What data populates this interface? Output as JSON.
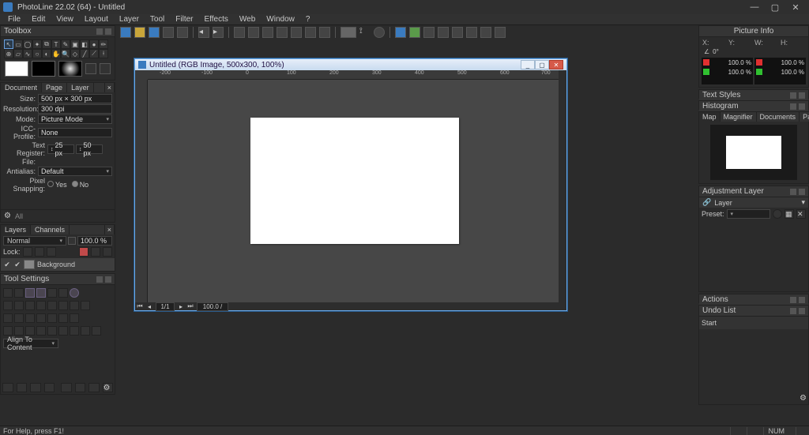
{
  "app": {
    "title": "PhotoLine 22.02 (64) - Untitled"
  },
  "menu": [
    "File",
    "Edit",
    "View",
    "Layout",
    "Layer",
    "Tool",
    "Filter",
    "Effects",
    "Web",
    "Window",
    "?"
  ],
  "panels": {
    "toolbox": {
      "title": "Toolbox"
    },
    "doc": {
      "tabs": [
        "Document",
        "Page",
        "Layer"
      ],
      "size_label": "Size:",
      "size_value": "500 px × 300 px",
      "resolution_label": "Resolution:",
      "resolution_value": "300 dpi",
      "mode_label": "Mode:",
      "mode_value": "Picture Mode",
      "icc_label": "ICC-Profile:",
      "icc_value": "None",
      "textreg_label": "Text Register:",
      "textreg_x": "25 px",
      "textreg_y": "50 px",
      "file_label": "File:",
      "file_value": "",
      "antialias_label": "Antialias:",
      "antialias_value": "Default",
      "pixelsnap_label": "Pixel Snapping:",
      "pixelsnap_yes": "Yes",
      "pixelsnap_no": "No"
    },
    "layers": {
      "tabs": [
        "Layers",
        "Channels"
      ],
      "mode": "Normal",
      "opacity": "100.0 %",
      "lock_label": "Lock:",
      "layer_name": "Background"
    },
    "toolsettings": {
      "title": "Tool Settings",
      "align": "Align To Content"
    },
    "picture_info": {
      "title": "Picture Info",
      "x": "X:",
      "y": "Y:",
      "w": "W:",
      "h": "H:",
      "angle": "0°",
      "left_top": "100.0 %",
      "left_bottom": "100.0 %",
      "right_top": "100.0 %",
      "right_bottom": "100.0 %"
    },
    "text_styles": {
      "title": "Text Styles"
    },
    "histogram": {
      "title": "Histogram"
    },
    "nav_tabs": [
      "Map",
      "Magnifier",
      "Documents",
      "Pages"
    ],
    "adjustment": {
      "title": "Adjustment Layer",
      "sublabel": "Layer",
      "preset_label": "Preset:"
    },
    "actions": {
      "title": "Actions"
    },
    "undo": {
      "title": "Undo List",
      "row": "Start"
    }
  },
  "canvas": {
    "title": "Untitled (RGB Image, 500x300, 100%)",
    "page": "1/1",
    "zoom": "100.0 /",
    "ruler_labels": [
      "-200",
      "-100",
      "0",
      "100",
      "200",
      "300",
      "400",
      "500",
      "600",
      "700"
    ]
  },
  "status": {
    "help": "For Help, press F1!",
    "num": "NUM"
  }
}
